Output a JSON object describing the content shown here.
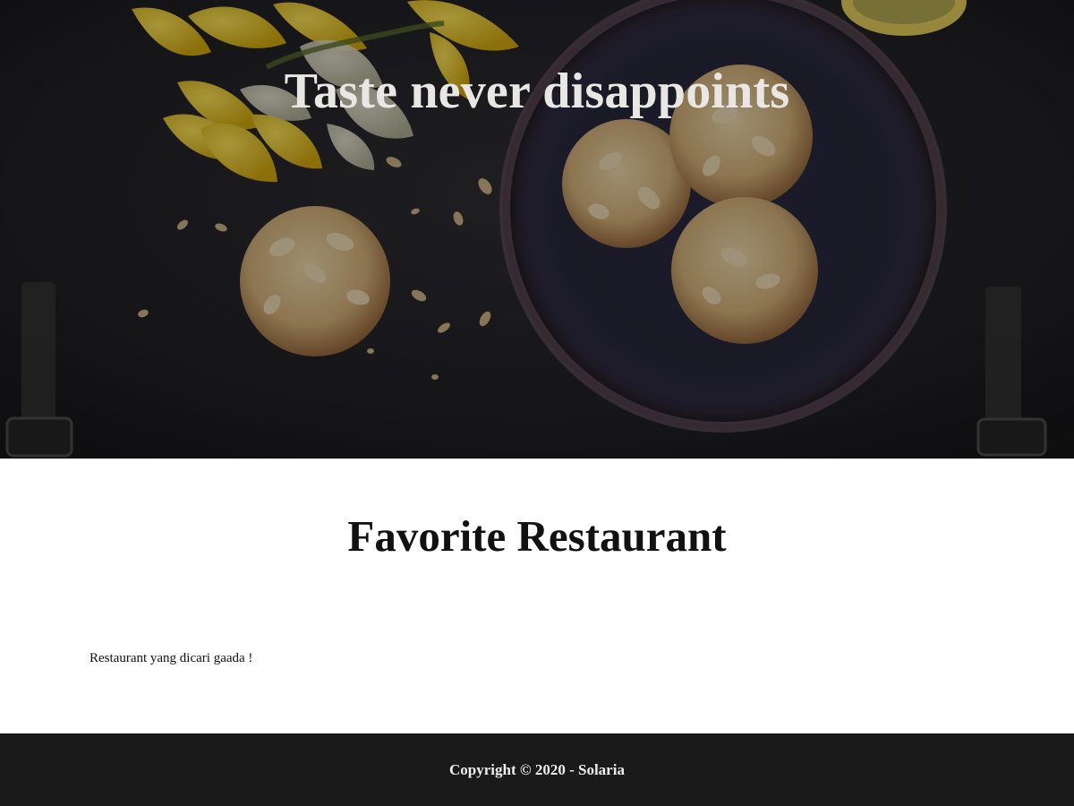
{
  "hero": {
    "title": "Taste never disappoints",
    "image_subject": "almond cookies in a dark bowl with yellow daffodils on a dark table"
  },
  "main": {
    "title": "Favorite Restaurant",
    "empty_message": "Restaurant yang dicari gaada !"
  },
  "footer": {
    "text": "Copyright © 2020 - Solaria"
  },
  "colors": {
    "hero_text": "#e9e7e4",
    "title_text": "#111111",
    "footer_background": "#1a1a1a",
    "footer_text": "#eeeeee"
  }
}
